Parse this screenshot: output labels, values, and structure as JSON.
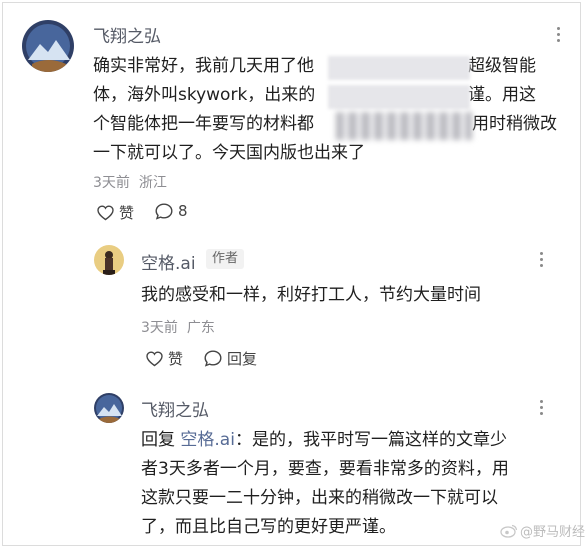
{
  "comment1": {
    "username": "飞翔之弘",
    "lines": [
      "确实非常好，我前几天用了他",
      "超级智能",
      "体，海外叫skywork，出来的",
      "谨。用这",
      "个智能体把一年要写的材料都",
      "用时稍微改",
      "一下就可以了。今天国内版也出来了"
    ],
    "time": "3天前",
    "location": "浙江",
    "like_label": "赞",
    "comment_count": "8"
  },
  "reply1": {
    "username": "空格.ai",
    "author_tag": "作者",
    "text": "我的感受和一样，利好打工人，节约大量时间",
    "time": "3天前",
    "location": "广东",
    "like_label": "赞",
    "reply_label": "回复"
  },
  "reply2": {
    "username": "飞翔之弘",
    "reply_prefix": "回复",
    "reply_to": "空格.ai",
    "line1_rest": "：是的，我平时写一篇这样的文章少",
    "line2": "者3天多者一个月，要查，要看非常多的资料，用",
    "line3": "这款只要一二十分钟，出来的稍微改一下就可以",
    "line4": "了，而且比自己写的更好更严谨。"
  },
  "watermark": "@野马财经"
}
